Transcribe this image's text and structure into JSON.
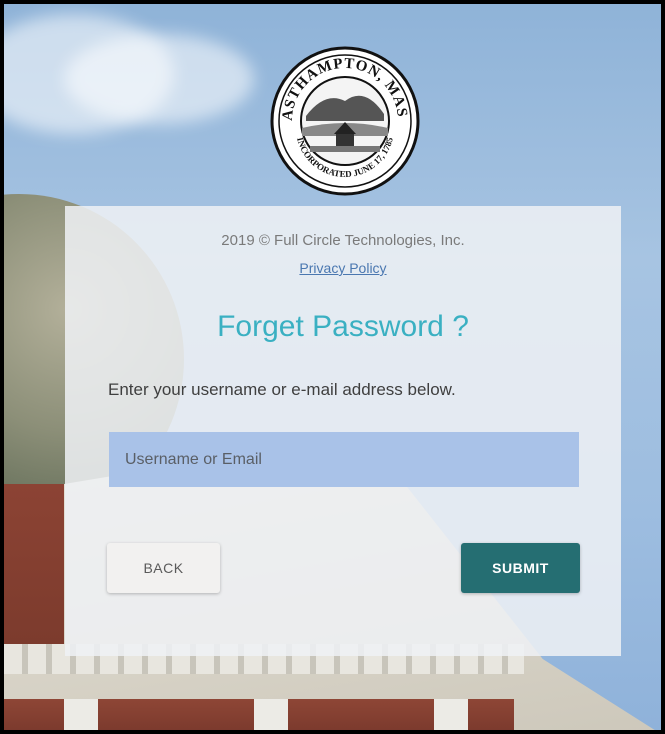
{
  "seal": {
    "top_text": "EASTHAMPTON, MASS.",
    "bottom_text": "INCORPORATED JUNE 17, 1785"
  },
  "footer": {
    "copyright": "2019 © Full Circle Technologies, Inc.",
    "privacy_link": "Privacy Policy"
  },
  "form": {
    "title": "Forget Password ?",
    "instructions": "Enter your username or e-mail address below.",
    "username_placeholder": "Username or Email",
    "username_value": "",
    "back_label": "BACK",
    "submit_label": "SUBMIT"
  },
  "colors": {
    "title": "#3ab0c2",
    "submit_bg": "#256e72",
    "input_bg": "#a9c2e8",
    "link": "#4a77b0"
  }
}
